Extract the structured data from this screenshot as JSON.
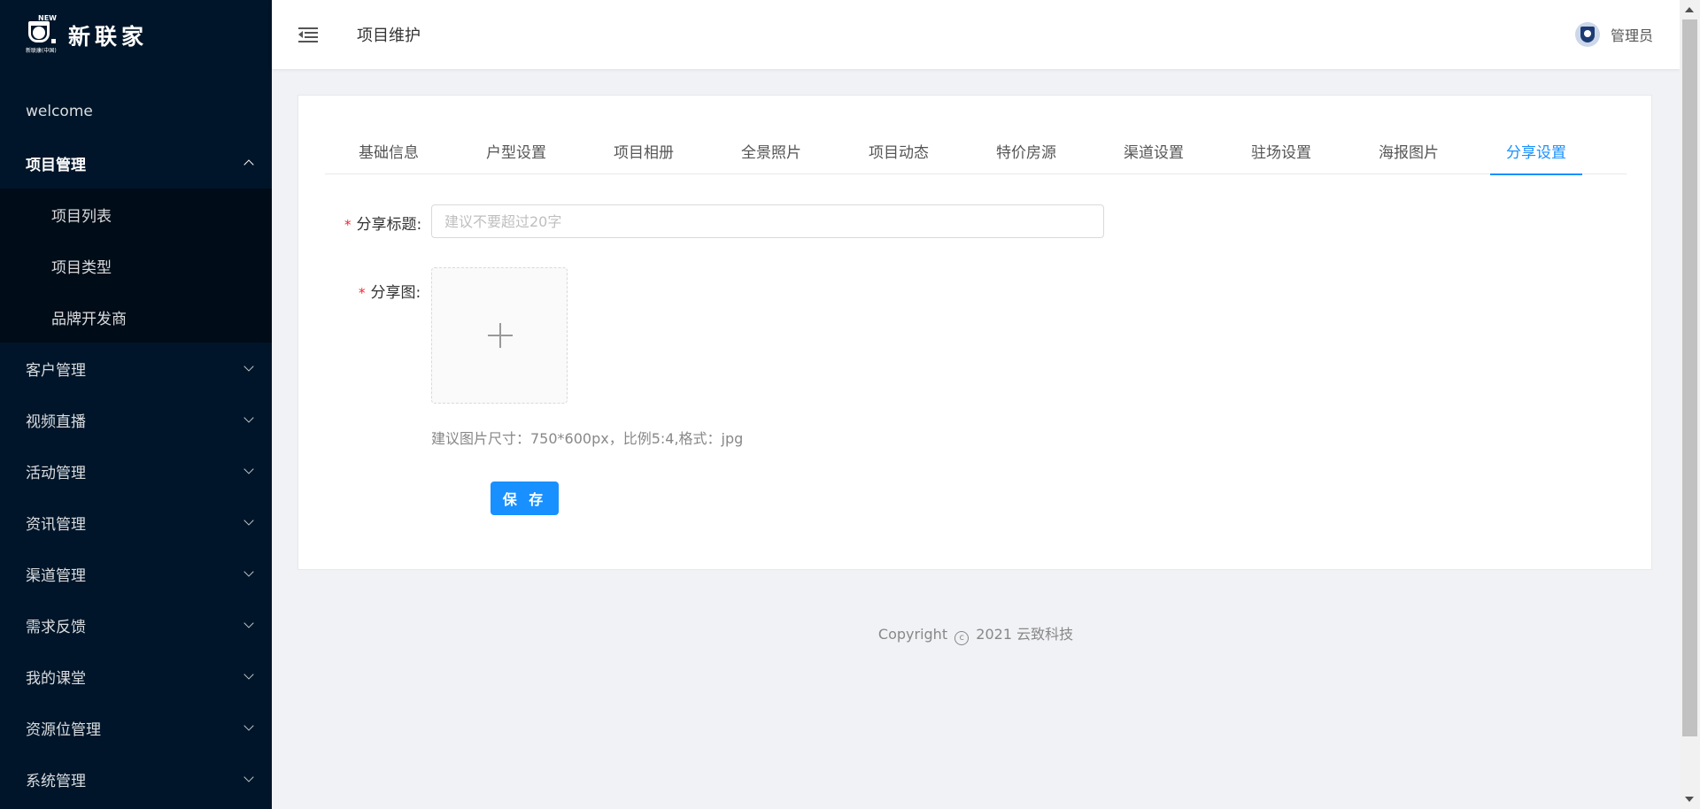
{
  "brand": {
    "name": "新联家",
    "logo_top": "NEW",
    "logo_sub": "新联康(中国)"
  },
  "sidebar": {
    "welcome": "welcome",
    "open_group": {
      "label": "项目管理",
      "items": [
        "项目列表",
        "项目类型",
        "品牌开发商"
      ]
    },
    "groups": [
      "客户管理",
      "视频直播",
      "活动管理",
      "资讯管理",
      "渠道管理",
      "需求反馈",
      "我的课堂",
      "资源位管理",
      "系统管理"
    ]
  },
  "header": {
    "title": "项目维护",
    "user": "管理员"
  },
  "tabs": {
    "items": [
      "基础信息",
      "户型设置",
      "项目相册",
      "全景照片",
      "项目动态",
      "特价房源",
      "渠道设置",
      "驻场设置",
      "海报图片",
      "分享设置"
    ],
    "active_index": 9
  },
  "form": {
    "title_label": "分享标题:",
    "title_placeholder": "建议不要超过20字",
    "title_value": "",
    "image_label": "分享图:",
    "image_hint": "建议图片尺寸：750*600px，比例5:4,格式：jpg",
    "save_label": "保 存"
  },
  "footer": {
    "prefix": "Copyright",
    "symbol": "c",
    "suffix": "2021 云致科技"
  },
  "colors": {
    "sidebar_bg": "#001529",
    "submenu_bg": "#000c17",
    "primary": "#1890ff",
    "required": "#f5222d"
  },
  "icons": {
    "fold": "menu-fold-icon",
    "plus": "plus-icon",
    "chevron": "chevron-down-icon",
    "chevron_open": "chevron-up-icon"
  }
}
